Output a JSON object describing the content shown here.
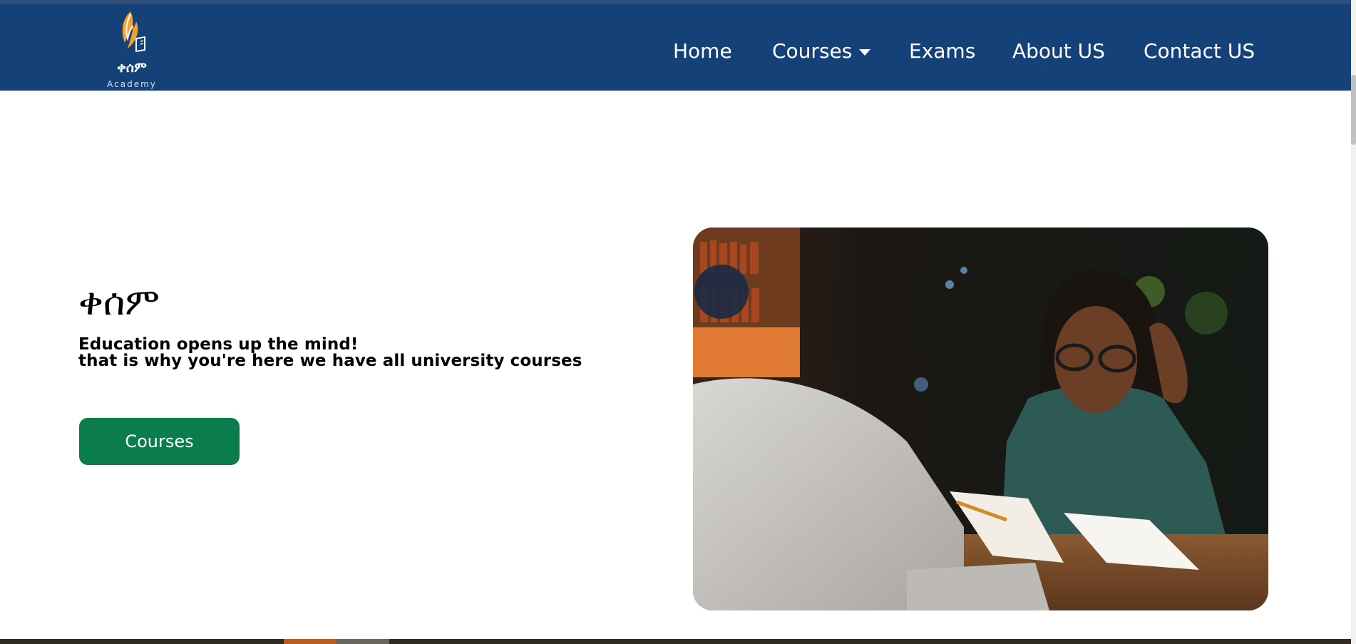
{
  "brand": {
    "logo_main": "ቀሰም",
    "logo_sub": "Academy"
  },
  "nav": {
    "items": [
      {
        "label": "Home"
      },
      {
        "label": "Courses"
      },
      {
        "label": "Exams"
      },
      {
        "label": "About US"
      },
      {
        "label": "Contact US"
      }
    ]
  },
  "hero": {
    "title": "ቀሰም",
    "line1": "Education opens up the mind!",
    "line2": "that is why you're here we have all university courses",
    "button_label": "Courses"
  },
  "colors": {
    "navbar": "#134178",
    "button": "#0b7d4c",
    "text": "#000000"
  },
  "icons": [
    "flame-quill-logo",
    "chevron-down-icon"
  ]
}
